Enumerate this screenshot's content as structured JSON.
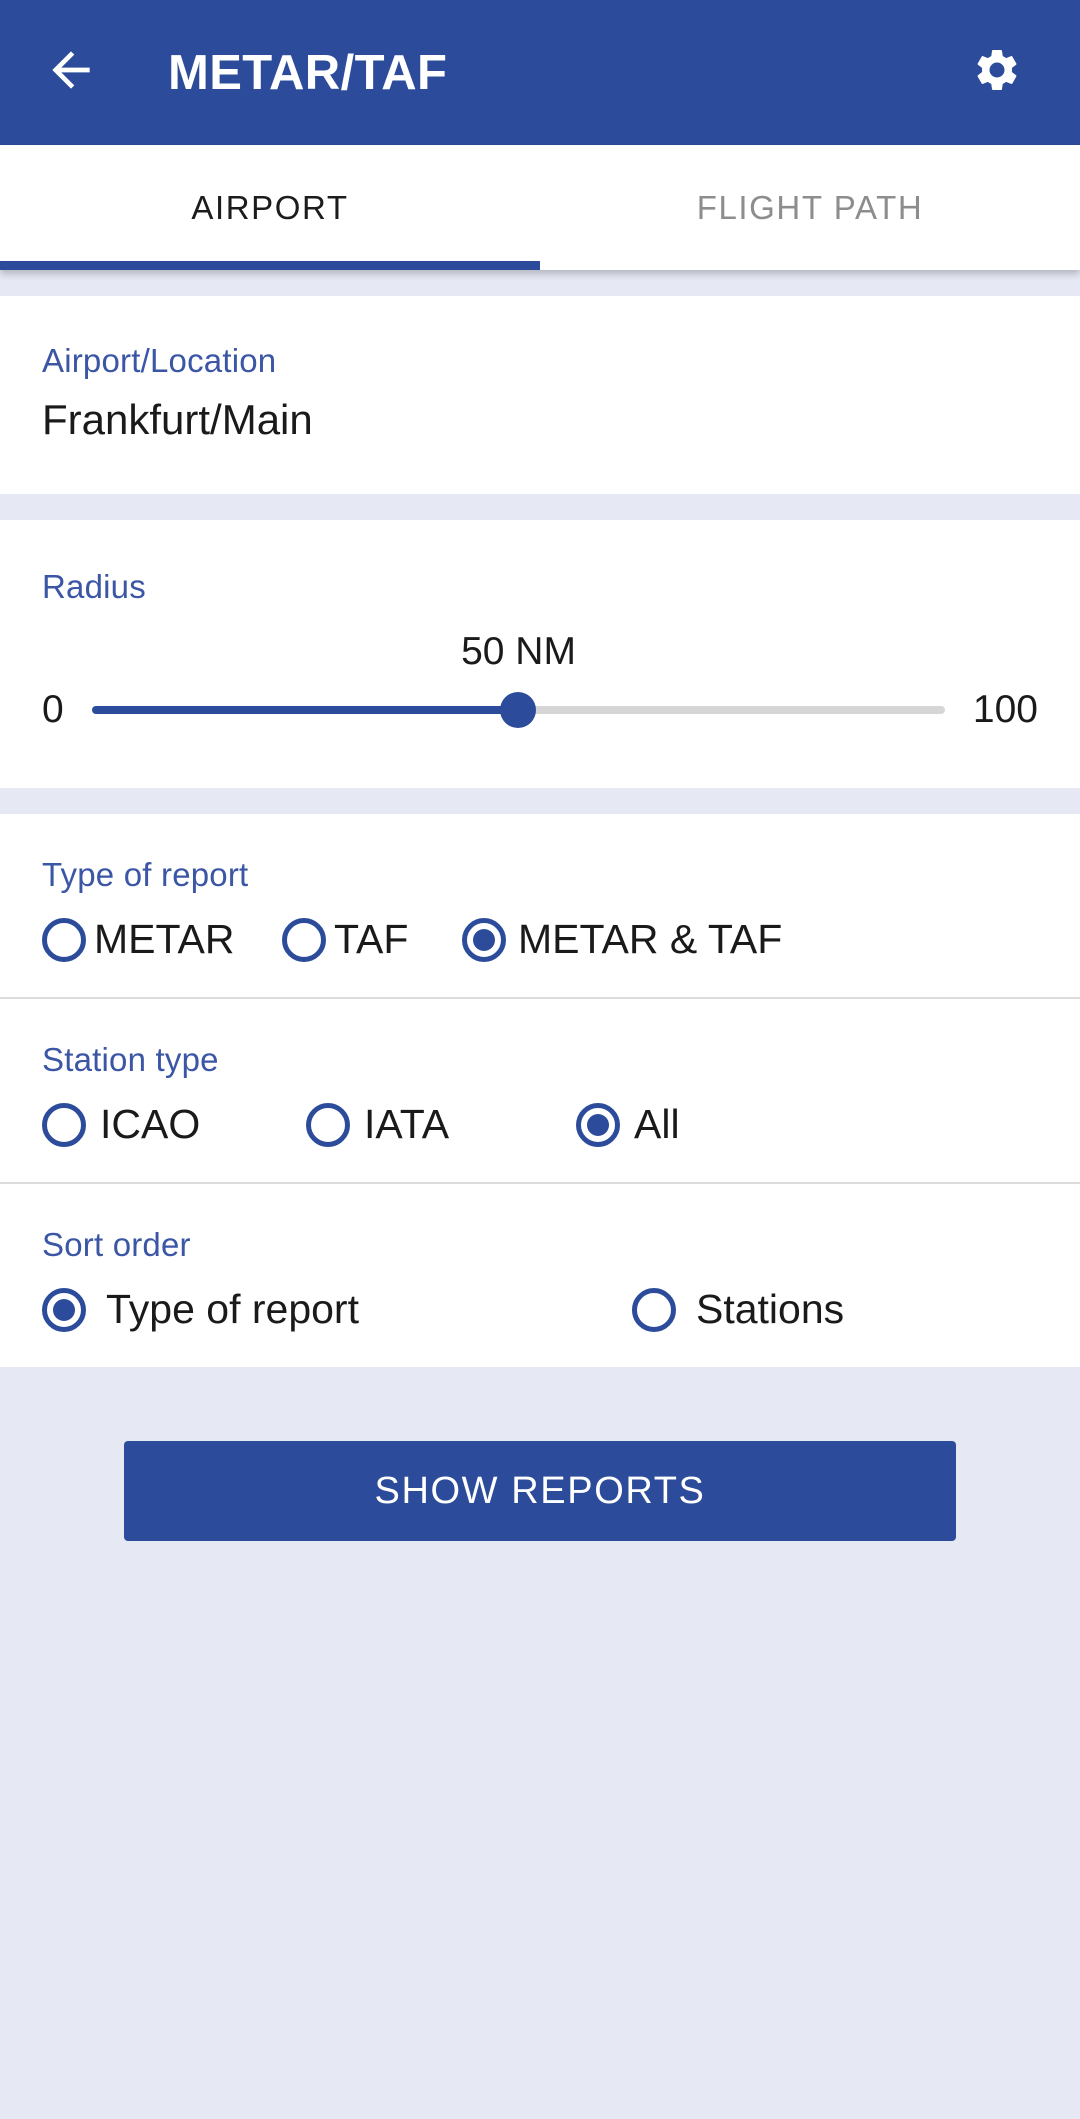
{
  "appbar": {
    "title": "METAR/TAF",
    "back_icon": "arrow-left-icon",
    "settings_icon": "gear-icon",
    "background_color": "#2c4c9b"
  },
  "tabs": [
    {
      "label": "AIRPORT",
      "active": true
    },
    {
      "label": "FLIGHT PATH",
      "active": false
    }
  ],
  "location": {
    "label": "Airport/Location",
    "value": "Frankfurt/Main",
    "placeholder": "Airport/Location"
  },
  "radius": {
    "label": "Radius",
    "value_text": "50 NM",
    "value": 50,
    "min_label": "0",
    "max_label": "100",
    "min": 0,
    "max": 100,
    "unit": "NM"
  },
  "report_type": {
    "label": "Type of report",
    "options": [
      {
        "label": "METAR",
        "checked": false
      },
      {
        "label": "TAF",
        "checked": false
      },
      {
        "label": "METAR & TAF",
        "checked": true
      }
    ]
  },
  "station_type": {
    "label": "Station type",
    "options": [
      {
        "label": "ICAO",
        "checked": false
      },
      {
        "label": "IATA",
        "checked": false
      },
      {
        "label": "All",
        "checked": true
      }
    ]
  },
  "sort_order": {
    "label": "Sort order",
    "options": [
      {
        "label": "Type of report",
        "checked": true
      },
      {
        "label": "Stations",
        "checked": false
      }
    ]
  },
  "actions": {
    "submit_label": "SHOW REPORTS"
  },
  "colors": {
    "primary": "#2c4c9b",
    "label_blue": "#3a56a5",
    "page_background": "#e6e9f4",
    "card_background": "#ffffff",
    "text": "#1a1a1a",
    "tab_inactive": "#8d8d8d",
    "track_inactive": "#d6d6d6"
  }
}
